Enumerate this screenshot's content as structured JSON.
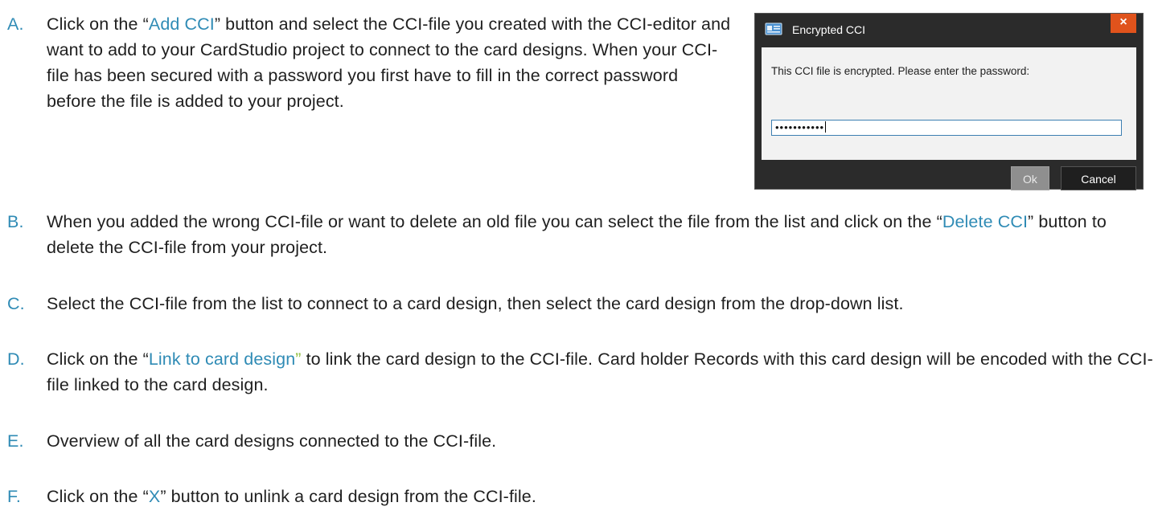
{
  "items": {
    "a": {
      "letter": "A.",
      "pre": "Click on the “",
      "link": "Add CCI",
      "post": "” button and select the CCI-file you created with the CCI-editor and want to add to your CardStudio project to connect to the card designs. When your CCI-file has been secured with a password you first have to fill in the correct password before the file is added to your project."
    },
    "b": {
      "letter": "B.",
      "pre": "When you added the wrong CCI-file or want to delete an old file you can select the file from the list and click on the “",
      "link": "Delete CCI",
      "post": "” button to delete the CCI-file from your project."
    },
    "c": {
      "letter": "C.",
      "text": "Select the CCI-file from the list to connect to a card design, then select the card design from the drop-down list."
    },
    "d": {
      "letter": "D.",
      "pre": "Click on the “",
      "link": "Link to card design",
      "link_end": "”",
      "post": " to link the card design to the CCI-file. Card holder Records with this card design will be encoded with the CCI-file linked to the card design."
    },
    "e": {
      "letter": "E.",
      "text": "Overview of all the card designs connected to the CCI-file."
    },
    "f": {
      "letter": "F.",
      "pre": "Click on the “",
      "link": "X",
      "post": "” button to unlink a card design from the CCI-file."
    }
  },
  "dialog": {
    "title": "Encrypted CCI",
    "close_label": "×",
    "message": "This CCI file is encrypted. Please enter the password:",
    "password_value": "•••••••••••",
    "ok_label": "Ok",
    "cancel_label": "Cancel"
  },
  "colors": {
    "link": "#2f8bb5",
    "link_quote_green": "#8fbf3d",
    "close_button": "#e0531c",
    "dialog_frame": "#2b2b2b"
  },
  "icons": {
    "dialog_icon": "id-card-icon"
  }
}
